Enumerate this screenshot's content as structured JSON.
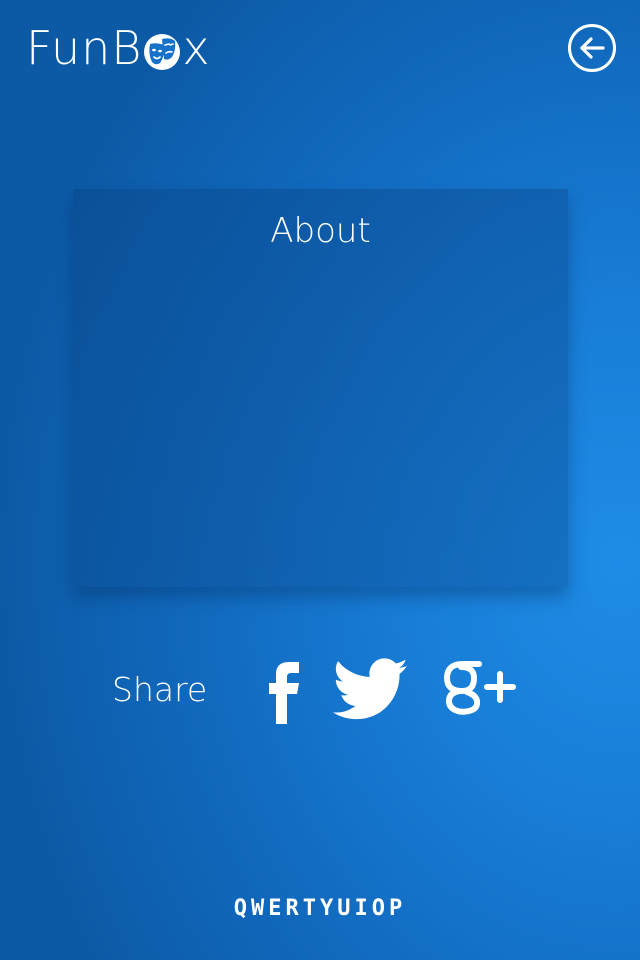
{
  "header": {
    "logo_prefix": "FunB",
    "logo_suffix": "x",
    "logo_icon": "theater-masks-icon",
    "back_icon": "arrow-left-circle-icon"
  },
  "about": {
    "title": "About"
  },
  "share": {
    "label": "Share",
    "networks": [
      {
        "name": "facebook",
        "icon": "facebook-icon"
      },
      {
        "name": "twitter",
        "icon": "twitter-icon"
      },
      {
        "name": "google-plus",
        "icon": "google-plus-icon"
      }
    ]
  },
  "footer": {
    "brand": "QWERTYUIOP"
  },
  "colors": {
    "background": "#187dd6",
    "background_dark": "#0c5aa6",
    "text": "#ffffff"
  }
}
